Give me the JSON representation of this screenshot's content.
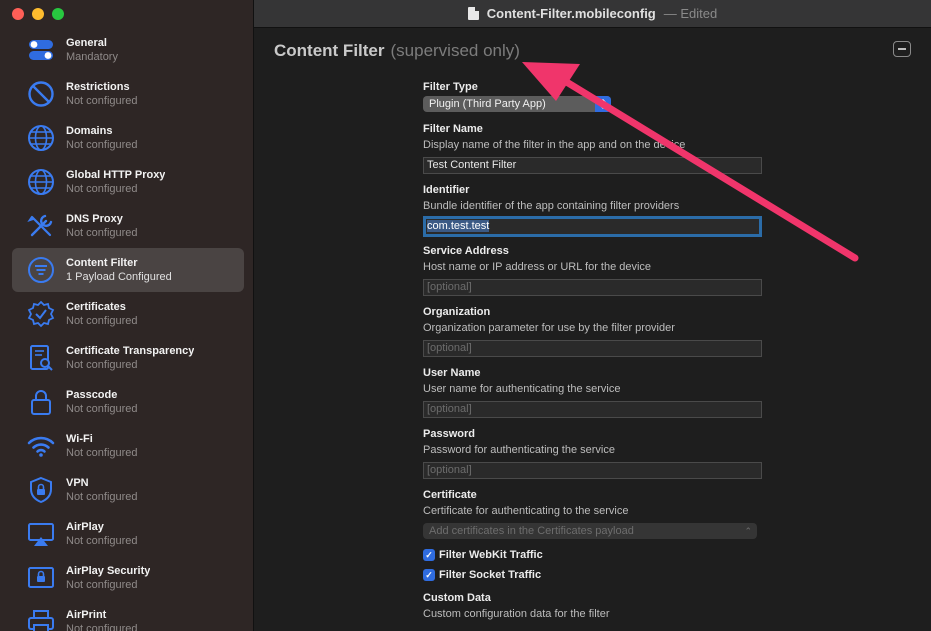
{
  "window": {
    "title": "Content-Filter.mobileconfig",
    "status": "— Edited"
  },
  "sidebar": {
    "items": [
      {
        "title": "General",
        "subtitle": "Mandatory",
        "icon": "toggle-switches-icon"
      },
      {
        "title": "Restrictions",
        "subtitle": "Not configured",
        "icon": "no-entry-icon"
      },
      {
        "title": "Domains",
        "subtitle": "Not configured",
        "icon": "globe-icon"
      },
      {
        "title": "Global HTTP Proxy",
        "subtitle": "Not configured",
        "icon": "globe-icon"
      },
      {
        "title": "DNS Proxy",
        "subtitle": "Not configured",
        "icon": "tools-icon"
      },
      {
        "title": "Content Filter",
        "subtitle": "1 Payload Configured",
        "icon": "filter-icon"
      },
      {
        "title": "Certificates",
        "subtitle": "Not configured",
        "icon": "certificate-badge-icon"
      },
      {
        "title": "Certificate Transparency",
        "subtitle": "Not configured",
        "icon": "document-search-icon"
      },
      {
        "title": "Passcode",
        "subtitle": "Not configured",
        "icon": "lock-icon"
      },
      {
        "title": "Wi-Fi",
        "subtitle": "Not configured",
        "icon": "wifi-icon"
      },
      {
        "title": "VPN",
        "subtitle": "Not configured",
        "icon": "vpn-shield-icon"
      },
      {
        "title": "AirPlay",
        "subtitle": "Not configured",
        "icon": "airplay-icon"
      },
      {
        "title": "AirPlay Security",
        "subtitle": "Not configured",
        "icon": "airplay-lock-icon"
      },
      {
        "title": "AirPrint",
        "subtitle": "Not configured",
        "icon": "printer-icon"
      }
    ],
    "selected_index": 5
  },
  "main": {
    "title": "Content Filter",
    "title_note": "(supervised only)",
    "filter_type": {
      "label": "Filter Type",
      "value": "Plugin (Third Party App)"
    },
    "filter_name": {
      "label": "Filter Name",
      "desc": "Display name of the filter in the app and on the device",
      "value": "Test Content Filter"
    },
    "identifier": {
      "label": "Identifier",
      "desc": "Bundle identifier of the app containing filter providers",
      "value": "com.test.test"
    },
    "service_address": {
      "label": "Service Address",
      "desc": "Host name or IP address or URL for the device",
      "placeholder": "[optional]"
    },
    "organization": {
      "label": "Organization",
      "desc": "Organization parameter for use by the filter provider",
      "placeholder": "[optional]"
    },
    "user_name": {
      "label": "User Name",
      "desc": "User name for authenticating the service",
      "placeholder": "[optional]"
    },
    "password": {
      "label": "Password",
      "desc": "Password for authenticating the service",
      "placeholder": "[optional]"
    },
    "certificate": {
      "label": "Certificate",
      "desc": "Certificate for authenticating to the service",
      "value": "Add certificates in the Certificates payload"
    },
    "webkit": {
      "label": "Filter WebKit Traffic",
      "checked": true
    },
    "socket": {
      "label": "Filter Socket Traffic",
      "checked": true
    },
    "custom_data": {
      "label": "Custom Data",
      "desc": "Custom configuration data for the filter"
    }
  },
  "colors": {
    "accent": "#2f6ce0",
    "annotation_arrow": "#f0356b",
    "sidebar_bg": "#2e2625",
    "main_bg": "#1e1e1e"
  }
}
